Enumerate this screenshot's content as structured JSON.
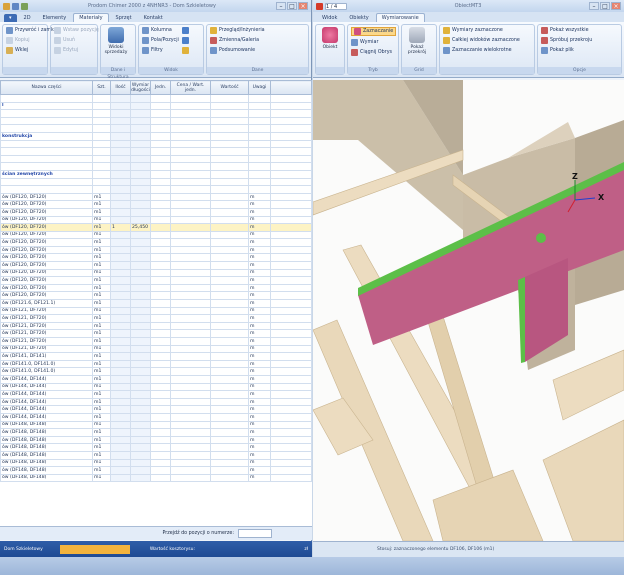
{
  "left_window": {
    "title": "Prodom Chimer 2000 z 4NHNR3 - Dom Szkieletowy",
    "tabs": [
      "2D",
      "Elementy",
      "Materiały",
      "Sprzęt",
      "Kontakt"
    ],
    "ribbon": {
      "groups": [
        {
          "label": "",
          "items": [
            "Przywróć i zamknij",
            "Kopiuj",
            "Wklej"
          ]
        },
        {
          "label": "",
          "items": [
            "Wstaw pozycję",
            "Usuń",
            "Edytuj"
          ]
        },
        {
          "label": "Dane i Struktura",
          "big": "Widoki sprzedaży"
        },
        {
          "label": "Widok",
          "items": [
            "Kolumna",
            "Pola/Pozycji",
            "Filtry"
          ]
        },
        {
          "label": "Dane",
          "items": [
            "Przegląd/Inżynieria",
            "Zmienna/Galeria",
            "Podsumowanie"
          ]
        }
      ]
    },
    "grid": {
      "headers": [
        "Nazwa części",
        "Szt.",
        "Ilość",
        "Wymiar długości",
        "Jedn.",
        "Cena / Wart. jedn.",
        "Wartość",
        "Uwagi"
      ],
      "rows": [
        [
          "",
          "",
          "",
          "",
          "",
          "",
          "",
          ""
        ],
        [
          "l",
          "",
          "",
          "",
          "",
          "",
          "",
          ""
        ],
        [
          "",
          "",
          "",
          "",
          "",
          "",
          "",
          ""
        ],
        [
          "",
          "",
          "",
          "",
          "",
          "",
          "",
          ""
        ],
        [
          "",
          "",
          "",
          "",
          "",
          "",
          "",
          ""
        ],
        [
          "konstrukcja",
          "",
          "",
          "",
          "",
          "",
          "",
          ""
        ],
        [
          "",
          "",
          "",
          "",
          "",
          "",
          "",
          ""
        ],
        [
          "",
          "",
          "",
          "",
          "",
          "",
          "",
          ""
        ],
        [
          "",
          "",
          "",
          "",
          "",
          "",
          "",
          ""
        ],
        [
          "",
          "",
          "",
          "",
          "",
          "",
          "",
          ""
        ],
        [
          "ścian zewnętrznych",
          "",
          "",
          "",
          "",
          "",
          "",
          ""
        ],
        [
          "",
          "",
          "",
          "",
          "",
          "",
          "",
          ""
        ],
        [
          "",
          "",
          "",
          "",
          "",
          "",
          "",
          ""
        ],
        [
          "ów (DF120, DF120)",
          "m1",
          "",
          "",
          "",
          "",
          "",
          "m"
        ],
        [
          "ów (DF120, DF720)",
          "m1",
          "",
          "",
          "",
          "",
          "",
          "m"
        ],
        [
          "ów (DF120, DF720)",
          "m1",
          "",
          "",
          "",
          "",
          "",
          "m"
        ],
        [
          "ów (DF120, DF720)",
          "m1",
          "",
          "",
          "",
          "",
          "",
          "m"
        ],
        [
          "ów (DF120, DF720)",
          "m1",
          "1",
          "25,450",
          "",
          "",
          "",
          "m"
        ],
        [
          "ów (DF120, DF720)",
          "m1",
          "",
          "",
          "",
          "",
          "",
          "m"
        ],
        [
          "ów (DF120, DF720)",
          "m1",
          "",
          "",
          "",
          "",
          "",
          "m"
        ],
        [
          "ów (DF120, DF720)",
          "m1",
          "",
          "",
          "",
          "",
          "",
          "m"
        ],
        [
          "ów (DF120, DF720)",
          "m1",
          "",
          "",
          "",
          "",
          "",
          "m"
        ],
        [
          "ów (DF120, DF720)",
          "m1",
          "",
          "",
          "",
          "",
          "",
          "m"
        ],
        [
          "ów (DF120, DF720)",
          "m1",
          "",
          "",
          "",
          "",
          "",
          "m"
        ],
        [
          "ów (DF120, DF720)",
          "m1",
          "",
          "",
          "",
          "",
          "",
          "m"
        ],
        [
          "ów (DF120, DF720)",
          "m1",
          "",
          "",
          "",
          "",
          "",
          "m"
        ],
        [
          "ów (DF120, DF720)",
          "m1",
          "",
          "",
          "",
          "",
          "",
          "m"
        ],
        [
          "ów (DF121.6, DF121.1)",
          "m1",
          "",
          "",
          "",
          "",
          "",
          "m"
        ],
        [
          "ów (DF121, DF720)",
          "m1",
          "",
          "",
          "",
          "",
          "",
          "m"
        ],
        [
          "ów (DF121, DF720)",
          "m1",
          "",
          "",
          "",
          "",
          "",
          "m"
        ],
        [
          "ów (DF121, DF720)",
          "m1",
          "",
          "",
          "",
          "",
          "",
          "m"
        ],
        [
          "ów (DF121, DF720)",
          "m1",
          "",
          "",
          "",
          "",
          "",
          "m"
        ],
        [
          "ów (DF121, DF720)",
          "m1",
          "",
          "",
          "",
          "",
          "",
          "m"
        ],
        [
          "ów (DF121, DF720)",
          "m1",
          "",
          "",
          "",
          "",
          "",
          "m"
        ],
        [
          "ów (DF141, DF141)",
          "m1",
          "",
          "",
          "",
          "",
          "",
          "m"
        ],
        [
          "ów (DF141.0, DF141.0)",
          "m1",
          "",
          "",
          "",
          "",
          "",
          "m"
        ],
        [
          "ów (DF141.0, DF141.0)",
          "m1",
          "",
          "",
          "",
          "",
          "",
          "m"
        ],
        [
          "ów (DF144, DF144)",
          "m1",
          "",
          "",
          "",
          "",
          "",
          "m"
        ],
        [
          "ów (DF144, DF144)",
          "m1",
          "",
          "",
          "",
          "",
          "",
          "m"
        ],
        [
          "ów (DF144, DF144)",
          "m1",
          "",
          "",
          "",
          "",
          "",
          "m"
        ],
        [
          "ów (DF144, DF144)",
          "m1",
          "",
          "",
          "",
          "",
          "",
          "m"
        ],
        [
          "ów (DF144, DF144)",
          "m1",
          "",
          "",
          "",
          "",
          "",
          "m"
        ],
        [
          "ów (DF144, DF144)",
          "m1",
          "",
          "",
          "",
          "",
          "",
          "m"
        ],
        [
          "ów (DF148, DF148)",
          "m1",
          "",
          "",
          "",
          "",
          "",
          "m"
        ],
        [
          "ów (DF148, DF148)",
          "m1",
          "",
          "",
          "",
          "",
          "",
          "m"
        ],
        [
          "ów (DF148, DF148)",
          "m1",
          "",
          "",
          "",
          "",
          "",
          "m"
        ],
        [
          "ów (DF148, DF148)",
          "m1",
          "",
          "",
          "",
          "",
          "",
          "m"
        ],
        [
          "ów (DF148, DF148)",
          "m1",
          "",
          "",
          "",
          "",
          "",
          "m"
        ],
        [
          "ów (DF148, DF148)",
          "m1",
          "",
          "",
          "",
          "",
          "",
          "m"
        ],
        [
          "ów (DF148, DF148)",
          "m1",
          "",
          "",
          "",
          "",
          "",
          "m"
        ],
        [
          "ów (DF148, DF148)",
          "m1",
          "",
          "",
          "",
          "",
          "",
          "m"
        ]
      ],
      "selected_row": 17,
      "group_rows": [
        1,
        5,
        10
      ]
    },
    "footer": {
      "label": "Przejdź do pozycji o numerze:"
    },
    "status": {
      "left": "Dom Szkieletowy",
      "mid": "Wartość kosztorysu:",
      "right": "zł"
    }
  },
  "right_window": {
    "title": "ObiectMT3",
    "address": "1 / 4",
    "tabs": [
      "Widok",
      "Obiekty",
      "Wymiarowanie"
    ],
    "ribbon": {
      "groups": [
        {
          "label": "",
          "big": "Obiekt"
        },
        {
          "label": "Tryb",
          "items": [
            "Zaznaczanie",
            "Wymiar",
            "Ciągnij Obrys"
          ]
        },
        {
          "label": "Grid",
          "big": "Pokaż przekrój"
        },
        {
          "label": "",
          "items": [
            "Wymiary zaznaczone",
            "Całkiej widoków zaznaczone",
            "Zaznaczanie wielokrotne"
          ]
        },
        {
          "label": "Opcje",
          "items": [
            "Pokaż wszystkie",
            "Spróbuj przekroju",
            "Pokaż plik"
          ]
        }
      ]
    },
    "axes": {
      "z": "Z",
      "x": "X"
    },
    "status": "Stosuj: zaznaczonego elementu DF106, DF106 (m1)"
  },
  "colors": {
    "ribbon_blue": "#3d6bb4",
    "wood": "#ecdcc0",
    "wall": "#c9bda9",
    "beam_pink": "#bf5f86",
    "beam_green": "#5cbf48",
    "selection": "#fdf3c4"
  }
}
